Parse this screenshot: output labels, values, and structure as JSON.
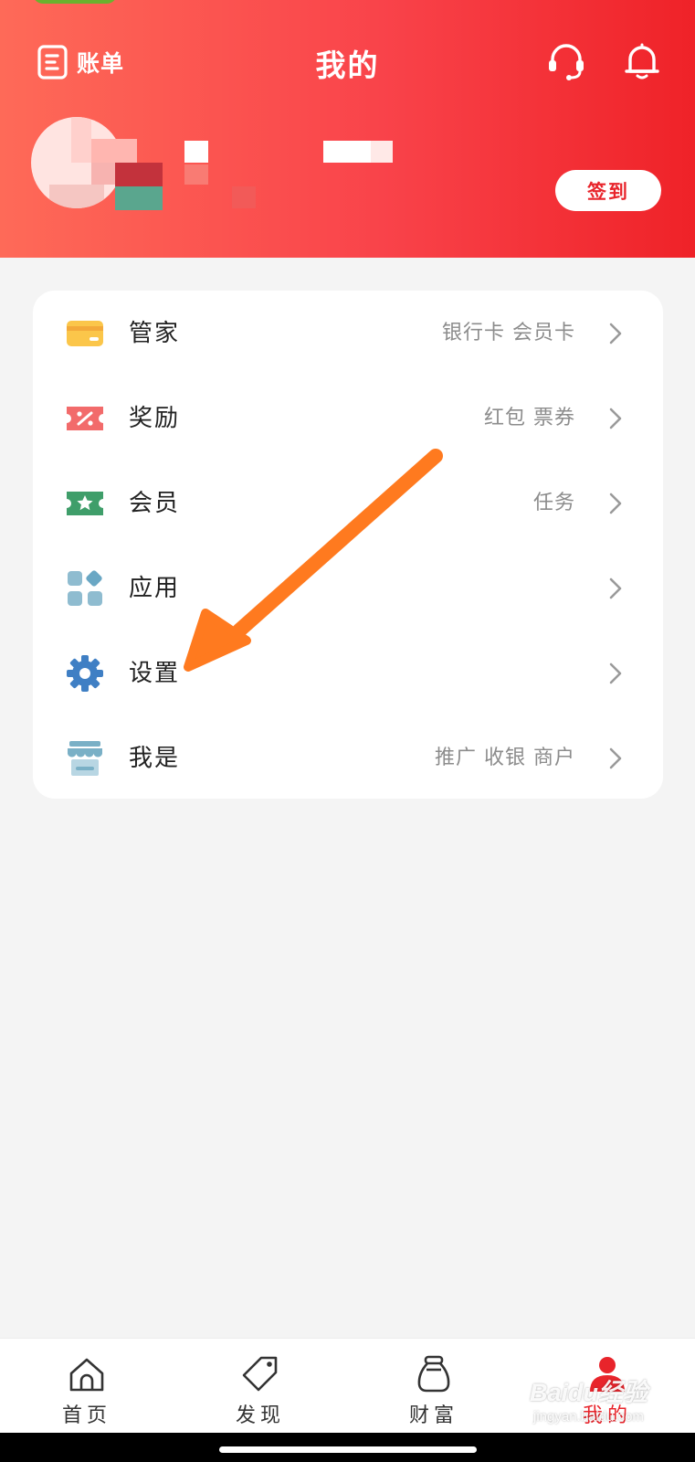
{
  "header": {
    "bill_label": "账单",
    "title": "我的",
    "signin_label": "签到",
    "customer_service_icon": "headset-icon",
    "notification_icon": "bell-icon"
  },
  "menu": {
    "items": [
      {
        "label": "管家",
        "hint": "银行卡 会员卡",
        "icon": "card-icon"
      },
      {
        "label": "奖励",
        "hint": "红包 票券",
        "icon": "coupon-icon"
      },
      {
        "label": "会员",
        "hint": "任务",
        "icon": "member-star-icon"
      },
      {
        "label": "应用",
        "hint": "",
        "icon": "apps-grid-icon"
      },
      {
        "label": "设置",
        "hint": "",
        "icon": "gear-icon"
      },
      {
        "label": "我是",
        "hint": "推广 收银 商户",
        "icon": "shop-icon"
      }
    ]
  },
  "tabbar": {
    "items": [
      {
        "label": "首页",
        "icon": "home-icon",
        "active": false
      },
      {
        "label": "发现",
        "icon": "tag-icon",
        "active": false
      },
      {
        "label": "财富",
        "icon": "money-bag-icon",
        "active": false
      },
      {
        "label": "我的",
        "icon": "person-icon",
        "active": true
      }
    ]
  },
  "watermark": {
    "logo": "Baidu经验",
    "url": "jingyan.baidu.com"
  },
  "colors": {
    "header_gradient_start": "#fe6a58",
    "header_gradient_end": "#ef2228",
    "accent_red": "#e8242b",
    "annotation_arrow": "#ff7a1f",
    "page_background": "#f4f4f4"
  }
}
